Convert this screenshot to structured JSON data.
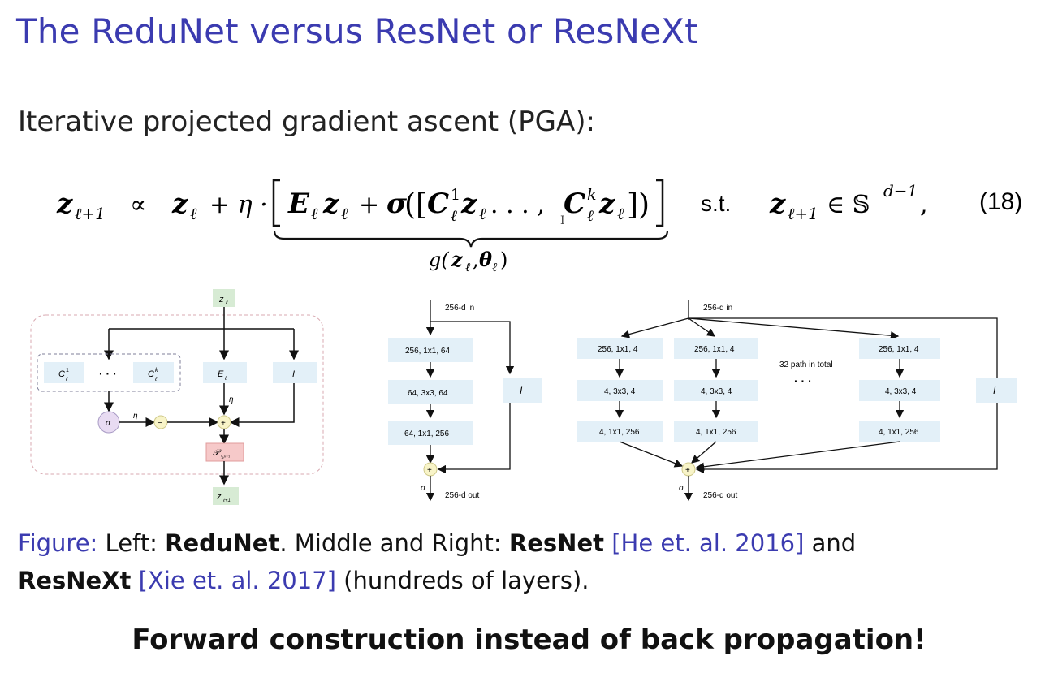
{
  "slide": {
    "title": "The ReduNet versus ResNet or ResNeXt",
    "intro": "Iterative projected gradient ascent (PGA):",
    "equation": {
      "lhs": "z",
      "lhs_sub": "ℓ+1",
      "propto": "∝",
      "z_l": "z",
      "sub_l": "ℓ",
      "plus_eta": "+ η ·",
      "E": "E",
      "sigma": "σ",
      "C": "C",
      "sup_1": "1",
      "sup_k": "k",
      "dots": ". . . ,",
      "underbrace_label_g": "g(",
      "underbrace_label_theta": "θ",
      "st": "s.t.",
      "in_sphere": "∈ 𝕊",
      "sphere_sup": "d−1",
      "comma": ",",
      "number": "(18)"
    },
    "redunet": {
      "input": "z",
      "input_sub": "ℓ",
      "C1": "C",
      "C1_sup": "1",
      "C1_sub": "ℓ",
      "dots": "· · ·",
      "Ck": "C",
      "Ck_sup": "k",
      "Ck_sub": "ℓ",
      "E": "E",
      "E_sub": "ℓ",
      "I": "I",
      "sigma": "σ",
      "eta1": "η",
      "eta2": "η",
      "minus": "−",
      "plus": "+",
      "proj": "𝒫",
      "proj_sub": "𝕊ⁿ⁻¹",
      "output": "z",
      "output_sub": "ℓ+1"
    },
    "resnet": {
      "in": "256-d in",
      "layers": [
        "256, 1x1, 64",
        "64, 3x3, 64",
        "64, 1x1, 256"
      ],
      "identity": "I",
      "plus": "+",
      "sigma": "σ",
      "out": "256-d out"
    },
    "resnext": {
      "in": "256-d in",
      "paths": [
        [
          "256, 1x1, 4",
          "4, 3x3, 4",
          "4, 1x1, 256"
        ],
        [
          "256, 1x1, 4",
          "4, 3x3, 4",
          "4, 1x1, 256"
        ],
        [
          "256, 1x1, 4",
          "4, 3x3, 4",
          "4, 1x1, 256"
        ]
      ],
      "path_note": "32 path in total",
      "dots": "· · ·",
      "identity": "I",
      "plus": "+",
      "sigma": "σ",
      "out": "256-d out"
    },
    "caption": {
      "figure_label": "Figure:",
      "left": " Left: ",
      "redunet": "ReduNet",
      "middle": ". Middle and Right: ",
      "resnet": "ResNet",
      "cite1": "[He et. al. 2016]",
      "and": " and",
      "resnext": "ResNeXt",
      "cite2": "[Xie et. al. 2017]",
      "tail": " (hundreds of layers)."
    },
    "slogan": "Forward construction instead of back propagation!"
  }
}
